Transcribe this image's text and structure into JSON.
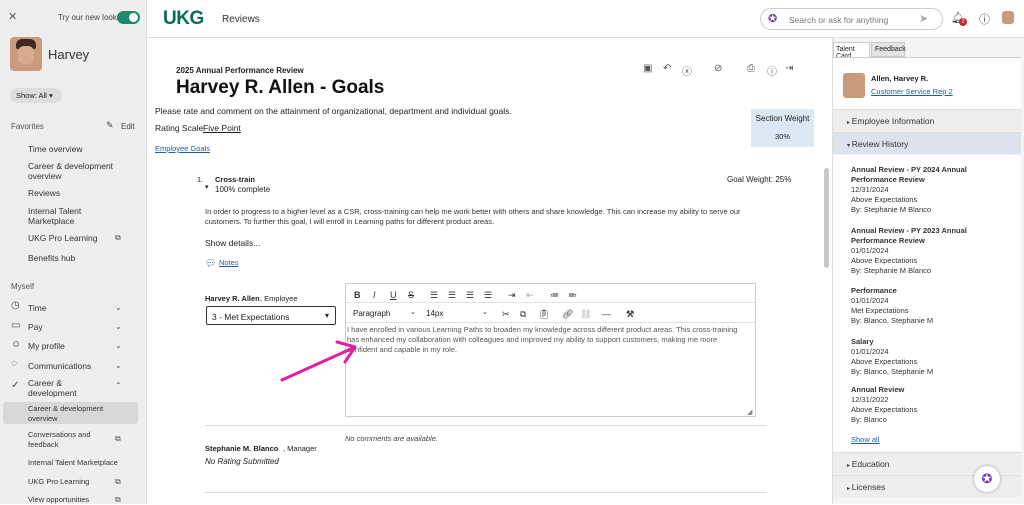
{
  "sidebar": {
    "close": "✕",
    "try_new_look": "Try our new look",
    "user_name": "Harvey",
    "show_all": "Show: All",
    "favorites_label": "Favorites",
    "edit_label": "Edit",
    "favorites": [
      "Time overview",
      "Career & development overview",
      "Reviews",
      "Internal Talent Marketplace",
      "UKG Pro Learning",
      "Benefits hub"
    ],
    "myself_label": "Myself",
    "myself": [
      "Time",
      "Pay",
      "My profile",
      "Communications",
      "Career & development"
    ],
    "career_sub": [
      "Career & development overview",
      "Conversations and feedback",
      "Internal Talent Marketplace",
      "UKG Pro Learning",
      "View opportunities"
    ]
  },
  "topbar": {
    "logo": "UKG",
    "title": "Reviews",
    "search_placeholder": "Search or ask for anything",
    "notif_count": "2"
  },
  "review": {
    "subtitle": "2025 Annual Performance Review",
    "employee": "Harvey R. Allen - Goals",
    "instructions": "Please rate and comment on the attainment of organizational, department and individual goals.",
    "rating_scale_label": "Rating Scale",
    "rating_scale_link": "Five Point",
    "section_weight_label": "Section Weight",
    "section_weight": "30%",
    "employee_goals_link": "Employee Goals",
    "goal_num": "1.",
    "goal_title": "Cross-train",
    "goal_complete": "100% complete",
    "goal_weight": "Goal Weight: 25%",
    "goal_desc": "In order to progress to a higher level as a CSR, cross-training can help me work better with others and share knowledge. This can increase my ability to serve our customers. To further this goal, I will enroll in Learning paths for different product areas.",
    "show_details": "Show details...",
    "notes": "Notes",
    "emp_name": "Harvey R. Allen",
    "emp_role": ", Employee",
    "rating_value": "3 - Met Expectations",
    "paragraph": "Paragraph",
    "font_size": "14px",
    "comment": "I have enrolled in various Learning Paths to broaden my knowledge across different product areas. This cross-training has enhanced my collaboration with colleagues and improved my ability to support customers, making me more confident and capable in my role.",
    "mgr_name": "Stephanie M. Blanco",
    "mgr_role": ", Manager",
    "no_comments": "No comments are available.",
    "no_rating": "No Rating Submitted"
  },
  "right": {
    "tab1": "Talent Card",
    "tab2": "Feedback",
    "name": "Allen, Harvey R.",
    "job": "Customer Service Rep 2",
    "employee_info": "Employee Information",
    "review_history": "Review History",
    "history": [
      {
        "title": "Annual Review - PY 2024 Annual Performance Review",
        "date": "12/31/2024",
        "result": "Above Expectations",
        "by": "By: Stephanie M Blanco"
      },
      {
        "title": "Annual Review - PY 2023 Annual Performance Review",
        "date": "01/01/2024",
        "result": "Above Expectations",
        "by": "By: Stephanie M Blanco"
      },
      {
        "title": "Performance",
        "date": "01/01/2024",
        "result": "Met Expectations",
        "by": "By: Blanco, Stephanie M"
      },
      {
        "title": "Salary",
        "date": "01/01/2024",
        "result": "Above Expectations",
        "by": "By: Blanco, Stephanie M"
      },
      {
        "title": "Annual Review",
        "date": "12/31/2022",
        "result": "Above Expectations",
        "by": "By: Blanco"
      }
    ],
    "show_all": "Show all",
    "education": "Education",
    "licenses": "Licenses"
  },
  "colors": {
    "brand": "#0b6b57",
    "accent": "#e020a0"
  }
}
